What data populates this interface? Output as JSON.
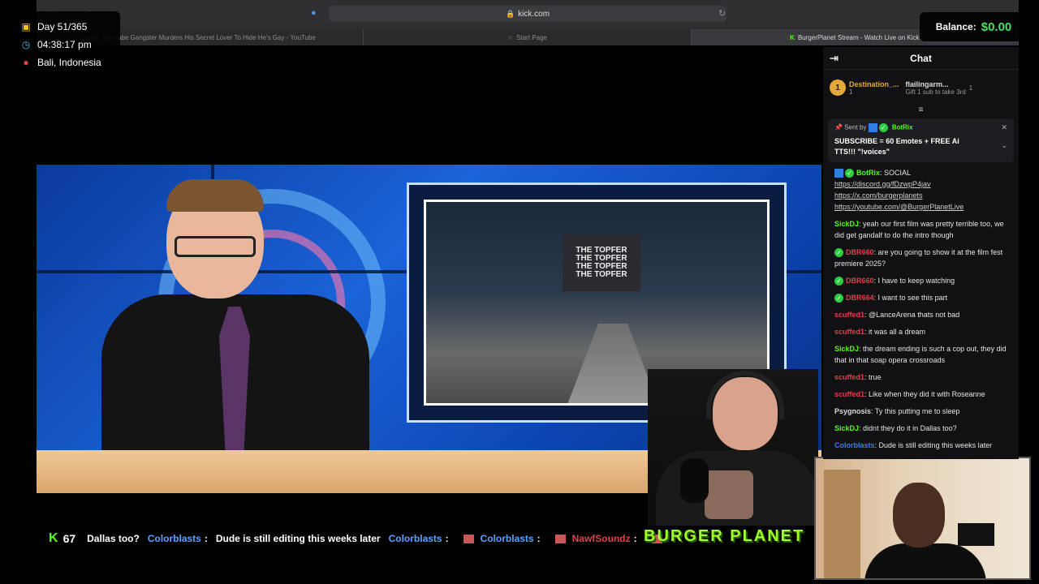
{
  "browser": {
    "url": "kick.com",
    "tabs": [
      {
        "label": "(188) Wannabe Gangster Murders His Secret Lover To Hide He's Gay - YouTube",
        "active": false
      },
      {
        "label": "Start Page",
        "active": false
      },
      {
        "label": "BurgerPlanet Stream - Watch Live on Kick",
        "active": true
      }
    ]
  },
  "overlay": {
    "day": "Day 51/365",
    "time": "04:38:17 pm",
    "location": "Bali, Indonesia",
    "balance_label": "Balance:",
    "balance_value": "$0.00"
  },
  "stream": {
    "screen_text": [
      "THE TOPFER",
      "THE TOPFER",
      "THE TOPFER",
      "THE TOPFER"
    ],
    "brand_banner": "BURGER PLANET",
    "ticker": {
      "viewer_count": "67",
      "items": [
        {
          "type": "text",
          "text": "Dallas too?"
        },
        {
          "type": "user",
          "user": "Colorblasts",
          "color": "blue",
          "text": "Dude is still editing this weeks later"
        },
        {
          "type": "user",
          "user": "Colorblasts",
          "color": "blue",
          "text": ""
        },
        {
          "type": "user",
          "user": "Colorblasts",
          "color": "blue",
          "text": ""
        },
        {
          "type": "user",
          "user": "NawfSoundz",
          "color": "red",
          "text": ""
        }
      ]
    }
  },
  "chat": {
    "title": "Chat",
    "leaders": [
      {
        "rank": "1",
        "name": "Destination_...",
        "count": "1"
      },
      {
        "name": "flailingarm...",
        "count": "1",
        "sub": "Gift 1 sub to take 3rd"
      }
    ],
    "pinned": {
      "sent_by_label": "Sent by",
      "sender": "BotRix",
      "text": "SUBSCRIBE = 60 Emotes + FREE Ai TTS!!! \"!voices\""
    },
    "messages": [
      {
        "user": "BotRix",
        "color": "green",
        "bot": true,
        "text": "SOCIAL",
        "links": [
          "https://discord.gg/fDzwpP4jav",
          "https://x.com/burgerplanets",
          "https://youtube.com/@BurgerPlanetLive"
        ]
      },
      {
        "user": "SickDJ",
        "color": "green",
        "text": "yeah our first film was pretty terrible too, we did get gandalf to do the intro though"
      },
      {
        "user": "DBR660",
        "color": "red",
        "verified": true,
        "text": "are you going to show it at the film fest premiere 2025?"
      },
      {
        "user": "DBR660",
        "color": "red",
        "verified": true,
        "text": "I have to keep watching"
      },
      {
        "user": "DBR664",
        "color": "red",
        "verified": true,
        "text": "I want to see this part"
      },
      {
        "user": "scuffed1",
        "color": "red",
        "text": "@LanceArena thats not bad"
      },
      {
        "user": "scuffed1",
        "color": "red",
        "text": "it was all a dream"
      },
      {
        "user": "SickDJ",
        "color": "green",
        "text": "the dream ending is such a cop out, they did that in that soap opera crossroads"
      },
      {
        "user": "scuffed1",
        "color": "red",
        "text": "true"
      },
      {
        "user": "scuffed1",
        "color": "red",
        "text": "Like when they did it with Roseanne"
      },
      {
        "user": "Psygnosis",
        "color": "grey",
        "text": "Ty this putting me to sleep"
      },
      {
        "user": "SickDJ",
        "color": "green",
        "text": "didnt they do it in Dallas too?"
      },
      {
        "user": "Colorblasts",
        "color": "blue",
        "text": "Dude is still editing this weeks later"
      }
    ]
  }
}
